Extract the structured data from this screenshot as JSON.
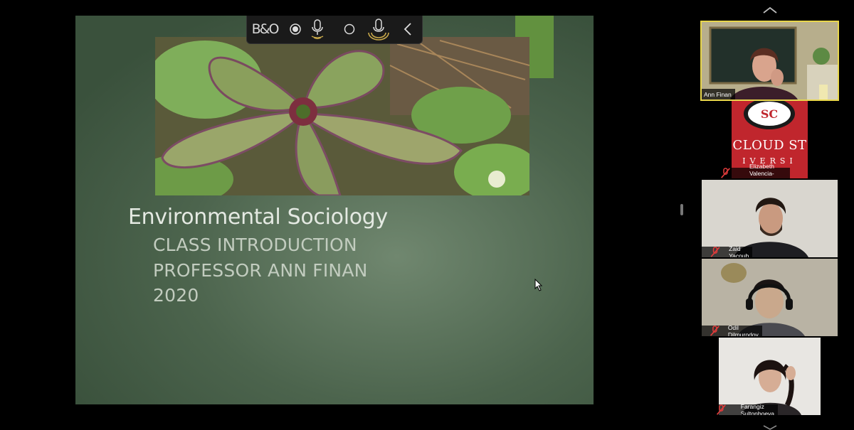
{
  "slide": {
    "title": "Environmental Sociology",
    "lines": [
      "CLASS INTRODUCTION",
      "PROFESSOR ANN FINAN",
      "2020"
    ]
  },
  "toolbar": {
    "brand_label": "B&O",
    "icons": [
      "record-dot-icon",
      "microphone-icon",
      "record-circle-icon",
      "speaker-mic-icon",
      "collapse-chevron-icon"
    ]
  },
  "participants": [
    {
      "name": "Ann Finan",
      "active": true,
      "muted": false
    },
    {
      "name": "Elizabeth Valencia-Borgert",
      "active": false,
      "muted": true,
      "tile_text": [
        "CLOUD ST",
        "IVERSI"
      ]
    },
    {
      "name": "Zaid Yacoub",
      "active": false,
      "muted": true
    },
    {
      "name": "Odil Dilmurodov",
      "active": false,
      "muted": true
    },
    {
      "name": "Farangiz Sultonboeva",
      "active": false,
      "muted": true
    }
  ],
  "colors": {
    "accent_bar": "#62913f",
    "active_speaker_border": "#e8d64b",
    "muted_icon": "#e03b3b",
    "slide_bg": "#4c644d"
  }
}
